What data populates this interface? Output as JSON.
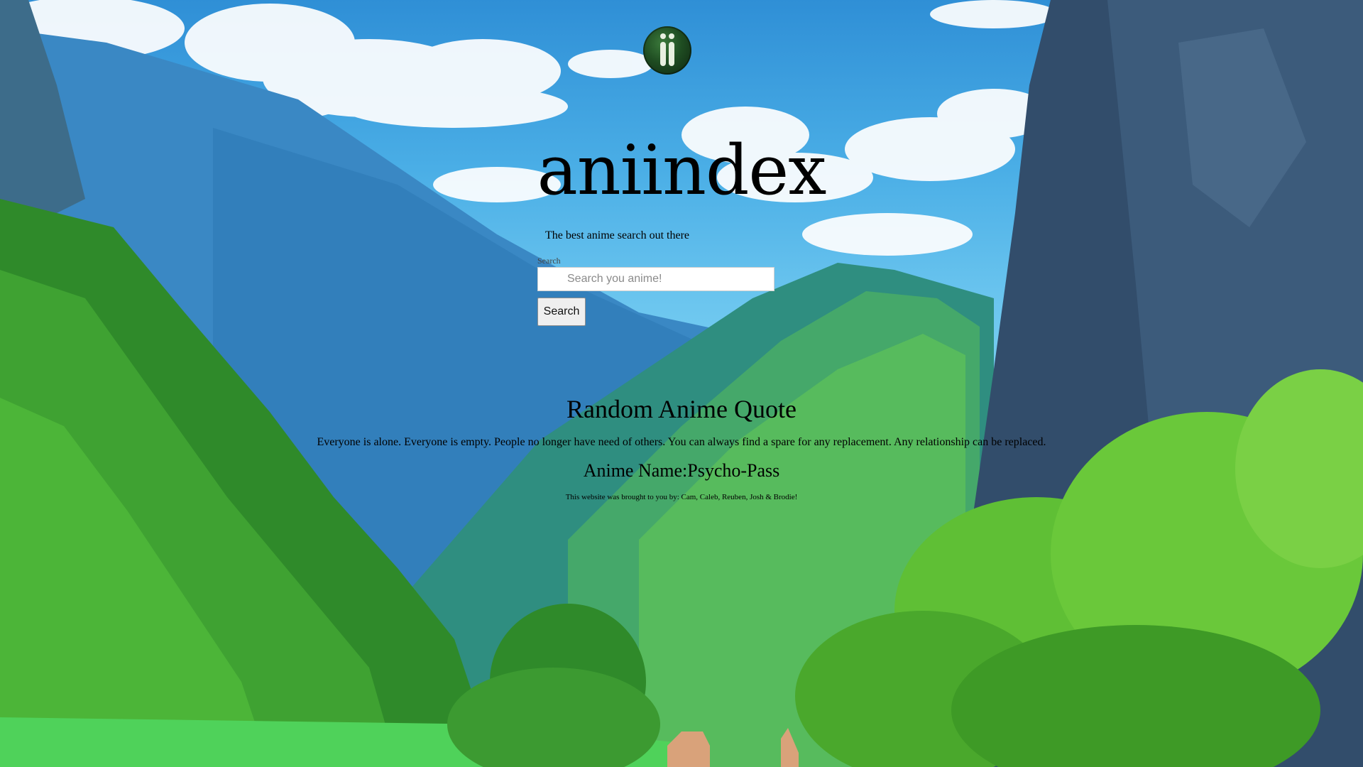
{
  "site": {
    "title": "aniindex",
    "tagline": "The best anime search out there"
  },
  "search": {
    "label": "Search",
    "placeholder": "Search you anime!",
    "value": "",
    "button_label": "Search"
  },
  "quote": {
    "heading": "Random Anime Quote",
    "text": "Everyone is alone. Everyone is empty. People no longer have need of others. You can always find a spare for any replacement. Any relationship can be replaced.",
    "anime_label": "Anime Name:",
    "anime_name": "Psycho-Pass"
  },
  "footer": {
    "credits": "This website was brought to you by: Cam, Caleb, Reuben, Josh & Brodie!"
  },
  "icons": {
    "logo": "aniindex-logo-icon"
  },
  "colors": {
    "sky": "#4aaee6",
    "foliage": "#3f9a2c",
    "cliff": "#2f4a6a"
  }
}
